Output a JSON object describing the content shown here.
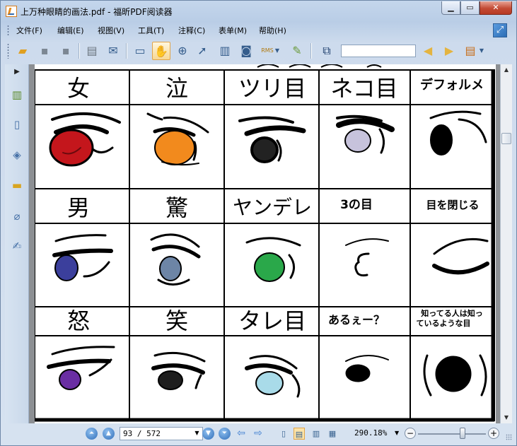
{
  "window": {
    "title": "上万种眼睛的画法.pdf - 福昕PDF阅读器",
    "minimize": "▁",
    "maximize": "▭",
    "close": "✕"
  },
  "menu": [
    "文件(F)",
    "编辑(E)",
    "视图(V)",
    "工具(T)",
    "注释(C)",
    "表单(M)",
    "帮助(H)"
  ],
  "toolbar": {
    "icons": [
      "open-folder-icon",
      "save-icon",
      "save-as-icon",
      "print-icon",
      "email-icon",
      "fullscreen-icon",
      "hand-icon",
      "zoom-icon",
      "select-icon",
      "text-select-icon",
      "snapshot-icon",
      "rms-icon",
      "signature-icon",
      "find-icon",
      "prev-result-icon",
      "next-result-icon",
      "highlight-icon"
    ],
    "rms_label": "RMS",
    "search_value": ""
  },
  "side_icons": [
    "bookmarks-icon",
    "pages-icon",
    "layers-icon",
    "comments-icon",
    "attachments-icon",
    "signatures-icon"
  ],
  "page": {
    "row1": [
      "女",
      "泣",
      "ツリ目",
      "ネコ目",
      "デフォルメ"
    ],
    "row2": [
      "男",
      "驚",
      "ヤンデレ",
      "3の目",
      "目を閉じる"
    ],
    "row3": [
      "怒",
      "笑",
      "タレ目",
      "あるぇー？",
      "知ってる人は知っているような目"
    ],
    "row3_last_line1": "知ってる人は知っ",
    "row3_last_line2": "ているような目"
  },
  "iris_colors": {
    "woman": "#c4161c",
    "cry": "#f28a1d",
    "tsuri": "#222222",
    "neko": "#c7c3dc",
    "man": "#3b3f9c",
    "surprise": "#6d85a6",
    "yandere": "#2aa84a",
    "angry": "#6a2ea3",
    "laugh": "#1e1e1e",
    "tare": "#a9dbe9"
  },
  "statusbar": {
    "page_value": "93 / 572",
    "zoom_value": "290.18%"
  }
}
